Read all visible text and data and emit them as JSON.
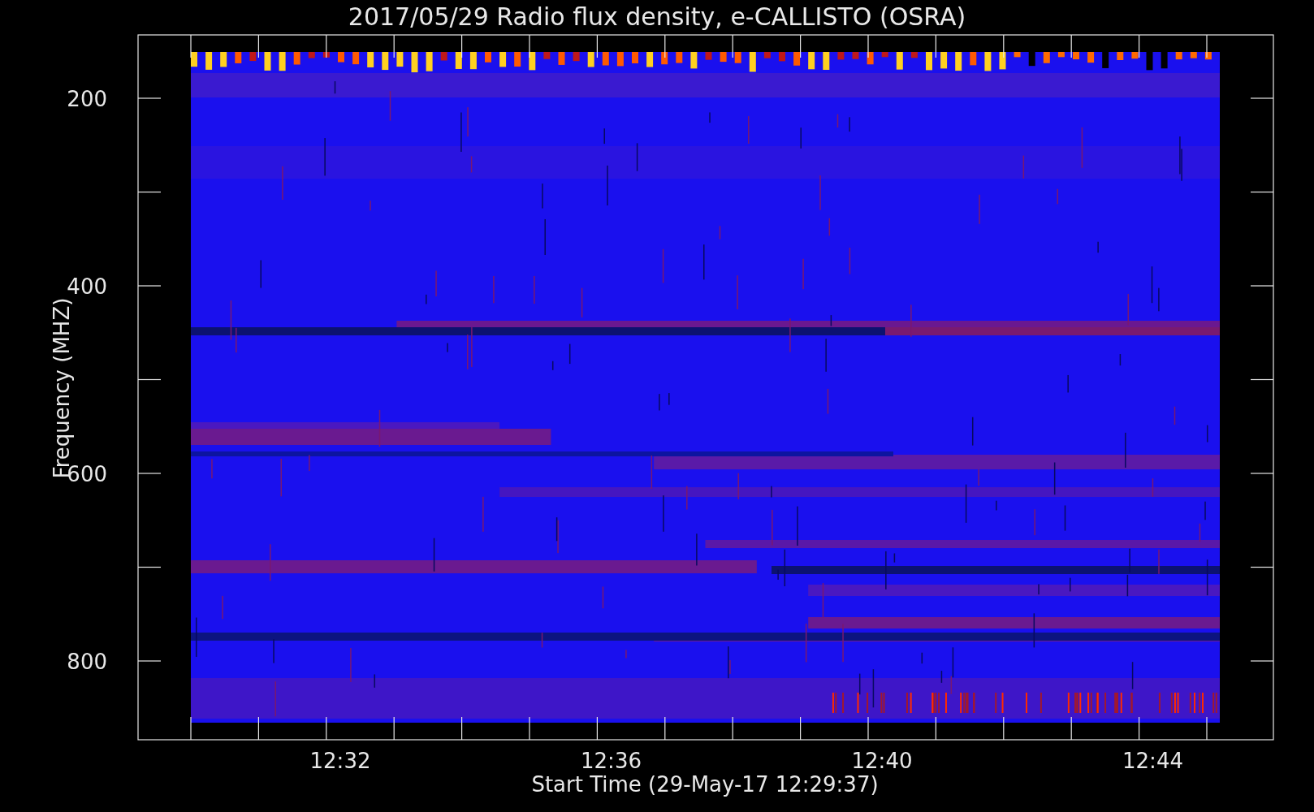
{
  "title": "2017/05/29  Radio flux density, e-CALLISTO (OSRA)",
  "plot": {
    "ylabel": "Frequency (MHZ)",
    "xlabel": "Start Time (29-May-17 12:29:37)",
    "yticks": [
      "200",
      "400",
      "600",
      "800"
    ],
    "xticks": [
      "12:32",
      "12:36",
      "12:40",
      "12:44"
    ]
  }
}
